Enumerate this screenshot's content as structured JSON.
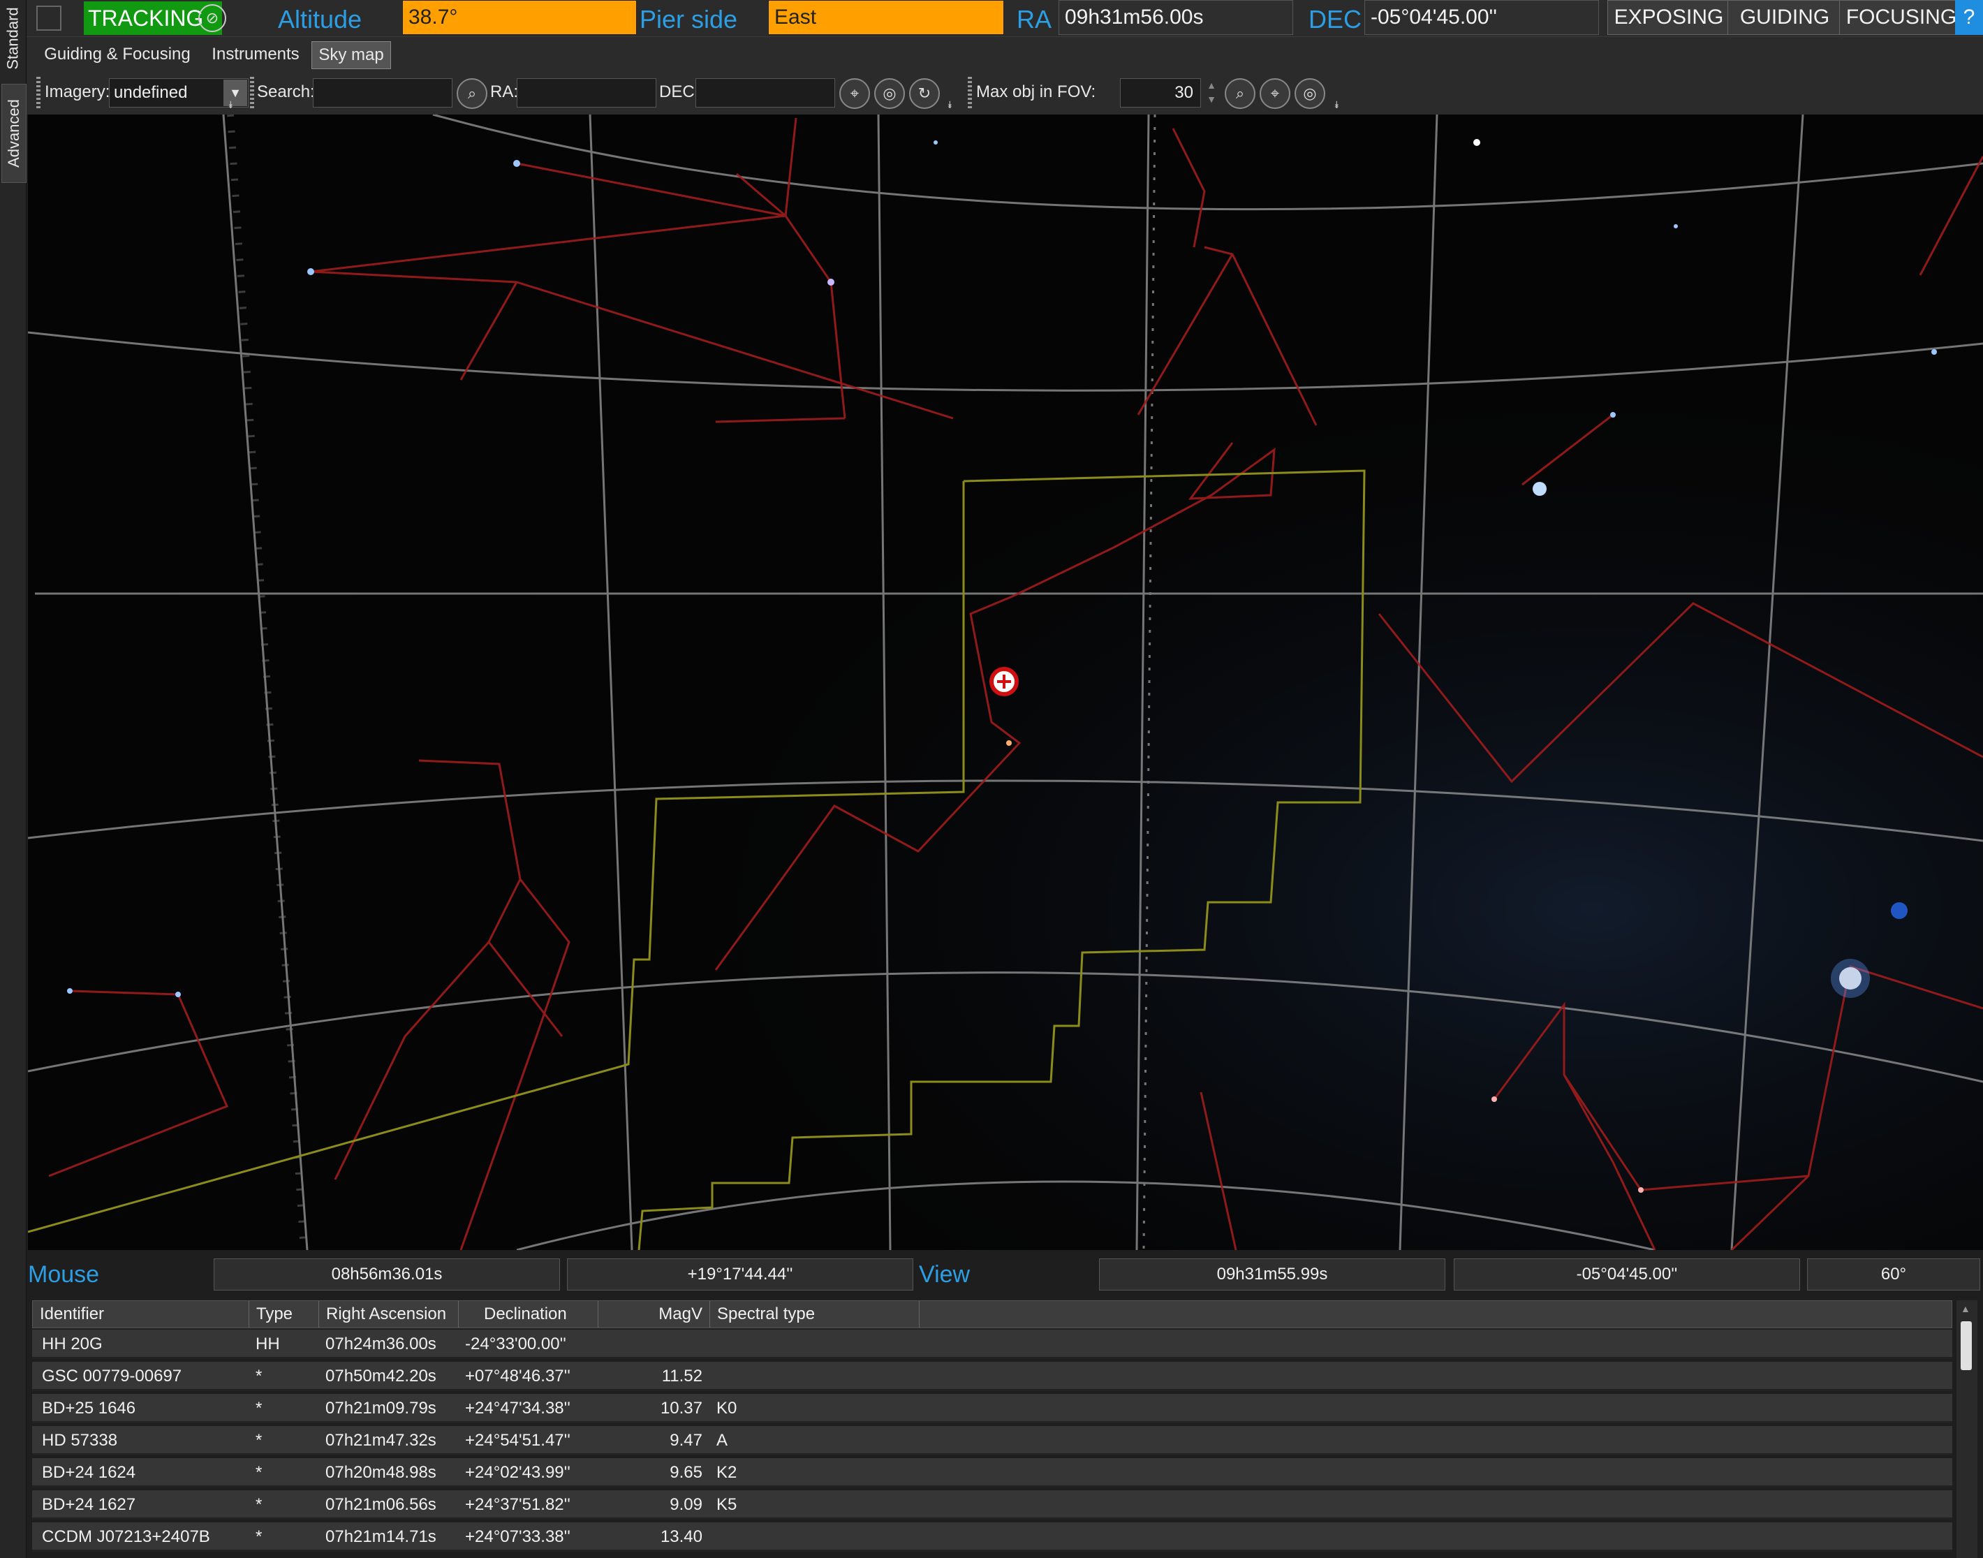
{
  "side_tabs": {
    "standard": "Standard",
    "advanced": "Advanced"
  },
  "status": {
    "tracking": "TRACKING",
    "altitude_label": "Altitude",
    "altitude_value": "38.7°",
    "pier_side_label": "Pier side",
    "pier_side_value": "East",
    "ra_label": "RA",
    "ra_value": "09h31m56.00s",
    "dec_label": "DEC",
    "dec_value": "-05°04'45.00''",
    "exposing": "EXPOSING",
    "guiding": "GUIDING",
    "focusing": "FOCUSING",
    "help": "?"
  },
  "menu_tabs": [
    "Guiding & Focusing",
    "Instruments",
    "Sky map"
  ],
  "toolbar": {
    "imagery_label": "Imagery:",
    "imagery_value": "undefined",
    "search_label": "Search:",
    "ra_label": "RA:",
    "dec_label": "DEC:",
    "max_obj_label": "Max obj in FOV:",
    "max_obj_value": "30"
  },
  "readouts": {
    "mouse_label": "Mouse",
    "mouse_ra": "08h56m36.01s",
    "mouse_dec": "+19°17'44.44''",
    "view_label": "View",
    "view_ra": "09h31m55.99s",
    "view_dec": "-05°04'45.00''",
    "view_fov": "60°"
  },
  "table": {
    "columns": [
      "Identifier",
      "Type",
      "Right Ascension",
      "Declination",
      "MagV",
      "Spectral type"
    ],
    "rows": [
      [
        "HH 20G",
        "HH",
        "07h24m36.00s",
        "-24°33'00.00''",
        "",
        ""
      ],
      [
        "GSC 00779-00697",
        "*",
        "07h50m42.20s",
        "+07°48'46.37''",
        "11.52",
        ""
      ],
      [
        "BD+25 1646",
        "*",
        "07h21m09.79s",
        "+24°47'34.38''",
        "10.37",
        "K0"
      ],
      [
        "HD 57338",
        "*",
        "07h21m47.32s",
        "+24°54'51.47''",
        "9.47",
        "A"
      ],
      [
        "BD+24 1624",
        "*",
        "07h20m48.98s",
        "+24°02'43.99''",
        "9.65",
        "K2"
      ],
      [
        "BD+24 1627",
        "*",
        "07h21m06.56s",
        "+24°37'51.82''",
        "9.09",
        "K5"
      ],
      [
        "CCDM J07213+2407B",
        "*",
        "07h21m14.71s",
        "+24°07'33.38''",
        "13.40",
        ""
      ]
    ]
  }
}
